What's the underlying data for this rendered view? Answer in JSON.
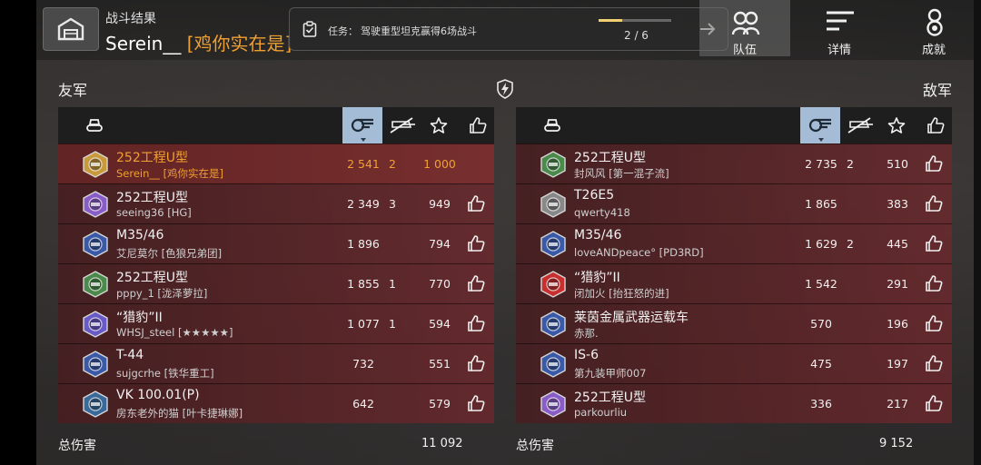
{
  "header": {
    "title": "战斗结果",
    "player_name": "Serein__",
    "player_clan": "[鸡你实在是]"
  },
  "mission": {
    "label": "任务：",
    "text": "驾驶重型坦克赢得6场战斗",
    "progress_text": "2 / 6",
    "progress_fraction": 0.33
  },
  "tabs": [
    {
      "label": "队伍",
      "icon": "team-icon",
      "active": true
    },
    {
      "label": "详情",
      "icon": "details-icon",
      "active": false
    },
    {
      "label": "成就",
      "icon": "achievement-icon",
      "active": false
    }
  ],
  "allies": {
    "title": "友军",
    "total_label": "总伤害",
    "total_damage": "11 092",
    "rows": [
      {
        "tank": "252工程U型",
        "player": "Serein__ [鸡你实在是]",
        "damage": "2 541",
        "kills": "2",
        "xp": "1 000",
        "me": true,
        "badge_color": "#c89a3c"
      },
      {
        "tank": "252工程U型",
        "player": "seeing36 [HG]",
        "damage": "2 349",
        "kills": "3",
        "xp": "949",
        "badge_color": "#8a5cc8"
      },
      {
        "tank": "M35/46",
        "player": "艾尼莫尔 [色狼兄弟团]",
        "damage": "1 896",
        "kills": "",
        "xp": "794",
        "badge_color": "#3a5aa8"
      },
      {
        "tank": "252工程U型",
        "player": "pppy_1 [泷泽萝拉]",
        "damage": "1 855",
        "kills": "1",
        "xp": "770",
        "badge_color": "#4a8a4a"
      },
      {
        "tank": "“猎豹”II",
        "player": "WHSJ_steel [★★★★★]",
        "damage": "1 077",
        "kills": "1",
        "xp": "594",
        "badge_color": "#6a5ac8"
      },
      {
        "tank": "T-44",
        "player": "sujgcrhe [铁华重工]",
        "damage": "732",
        "kills": "",
        "xp": "551",
        "badge_color": "#3a5aa8"
      },
      {
        "tank": "VK 100.01(P)",
        "player": "房东老外的猫 [叶卡捷琳娜]",
        "damage": "642",
        "kills": "",
        "xp": "579",
        "badge_color": "#3a6a9a"
      }
    ]
  },
  "enemies": {
    "title": "敌军",
    "total_label": "总伤害",
    "total_damage": "9 152",
    "rows": [
      {
        "tank": "252工程U型",
        "player": "封风风 [第一混子流]",
        "damage": "2 735",
        "kills": "2",
        "xp": "510",
        "badge_color": "#4a8a4a"
      },
      {
        "tank": "T26E5",
        "player": "qwerty418",
        "damage": "1 865",
        "kills": "",
        "xp": "383",
        "badge_color": "#888888"
      },
      {
        "tank": "M35/46",
        "player": "loveANDpeace° [PD3RD]",
        "damage": "1 629",
        "kills": "2",
        "xp": "445",
        "badge_color": "#3a5aa8"
      },
      {
        "tank": "“猎豹”II",
        "player": "闭加火 [抬狂怒的进]",
        "damage": "1 542",
        "kills": "",
        "xp": "291",
        "badge_color": "#c83030"
      },
      {
        "tank": "莱茵金属武器运载车",
        "player": "赤那.",
        "damage": "570",
        "kills": "",
        "xp": "196",
        "badge_color": "#3a5aa8"
      },
      {
        "tank": "IS-6",
        "player": "第九装甲师007",
        "damage": "475",
        "kills": "",
        "xp": "197",
        "badge_color": "#3a5aa8"
      },
      {
        "tank": "252工程U型",
        "player": "parkourliu",
        "damage": "336",
        "kills": "",
        "xp": "217",
        "badge_color": "#8a5cc8"
      }
    ]
  }
}
